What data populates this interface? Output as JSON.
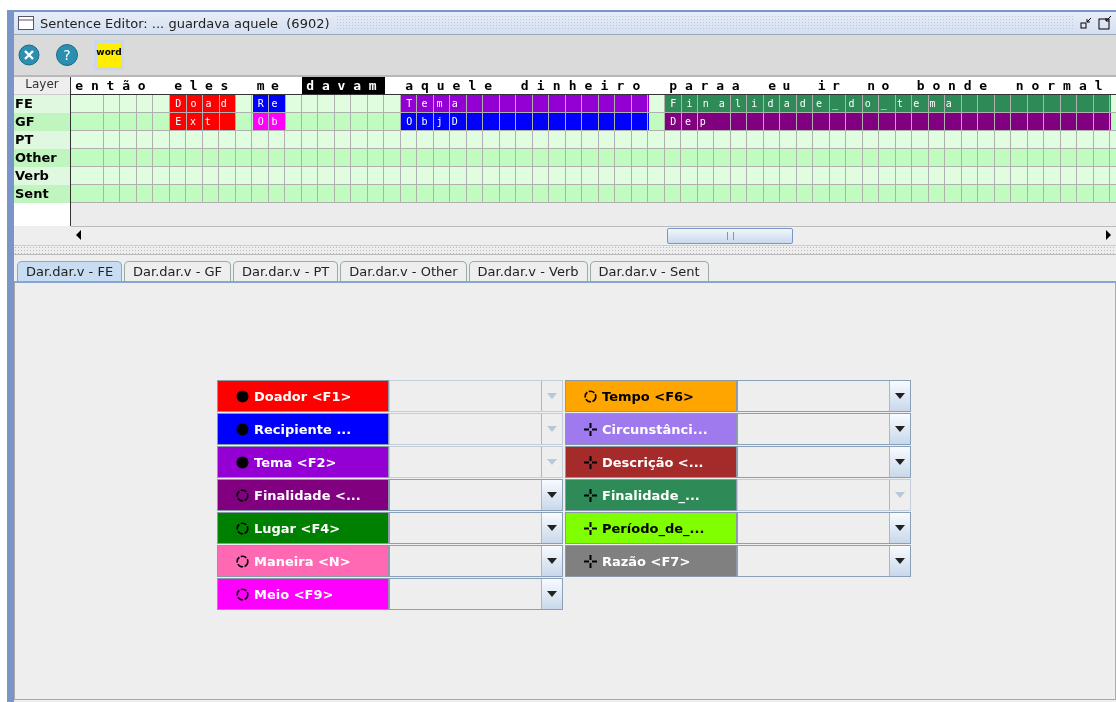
{
  "window": {
    "title": "Sentence Editor: ... guardava aquele  (6902)"
  },
  "toolbar": [
    {
      "kind": "close"
    },
    {
      "kind": "help",
      "label": "?"
    },
    {
      "kind": "word",
      "label": "word"
    }
  ],
  "grid": {
    "header": "Layer",
    "layers": [
      {
        "name": "FE",
        "kind": "fe"
      },
      {
        "name": "GF",
        "kind": "gf"
      },
      {
        "name": "PT",
        "kind": "pt"
      },
      {
        "name": "Other",
        "kind": "other"
      },
      {
        "name": "Verb",
        "kind": "verb"
      },
      {
        "name": "Sent",
        "kind": "sent"
      }
    ],
    "phrases": [
      {
        "words": [
          {
            "text": "então",
            "selected": false
          }
        ]
      },
      {
        "words": [
          {
            "text": "eles",
            "selected": false
          }
        ],
        "fe": {
          "label": "Doad",
          "color": "#ff0000"
        },
        "gf": {
          "label": "Ext",
          "color": "#ff0000"
        }
      },
      {
        "words": [
          {
            "text": "me",
            "selected": false
          }
        ],
        "fe": {
          "label": "Re",
          "color": "#0000ff"
        },
        "gf": {
          "label": "Ob",
          "color": "#ff00ff"
        }
      },
      {
        "words": [
          {
            "text": "davam",
            "selected": true
          }
        ]
      },
      {
        "words": [
          {
            "text": "aquele",
            "selected": false
          },
          {
            "text": "dinheiro",
            "selected": false
          }
        ],
        "fe": {
          "label": "Tema",
          "color": "#9400d3"
        },
        "gf": {
          "label": "ObjD",
          "color": "#0000ff"
        }
      },
      {
        "words": [
          {
            "text": "paraa",
            "selected": false
          },
          {
            "text": "eu",
            "selected": false
          },
          {
            "text": "ir",
            "selected": false
          },
          {
            "text": "no",
            "selected": false
          },
          {
            "text": "bonde",
            "selected": false
          },
          {
            "text": "normal",
            "selected": false
          }
        ],
        "fe": {
          "label": "Finalidade_do_tema",
          "color": "#2e8b57"
        },
        "gf": {
          "label": "Dep",
          "color": "#800080"
        }
      }
    ]
  },
  "tabs": [
    {
      "label": "Dar.dar.v - FE",
      "selected": true
    },
    {
      "label": "Dar.dar.v - GF",
      "selected": false
    },
    {
      "label": "Dar.dar.v - PT",
      "selected": false
    },
    {
      "label": "Dar.dar.v - Other",
      "selected": false
    },
    {
      "label": "Dar.dar.v - Verb",
      "selected": false
    },
    {
      "label": "Dar.dar.v - Sent",
      "selected": false
    }
  ],
  "frame_elements": [
    [
      {
        "label": "Doador <F1>",
        "color": "#ff0000",
        "kind": "core",
        "disabled": true
      },
      {
        "label": "Recipiente ...",
        "color": "#0000ff",
        "kind": "core",
        "disabled": true
      },
      {
        "label": "Tema <F2>",
        "color": "#9400d3",
        "kind": "core",
        "disabled": true
      },
      {
        "label": "Finalidade <...",
        "color": "#800080",
        "kind": "peripheral",
        "disabled": false
      },
      {
        "label": "Lugar <F4>",
        "color": "#008000",
        "kind": "peripheral",
        "disabled": false
      },
      {
        "label": "Maneira <N>",
        "color": "#ff69b4",
        "kind": "peripheral",
        "disabled": false
      },
      {
        "label": "Meio <F9>",
        "color": "#ff00ff",
        "kind": "peripheral",
        "disabled": false
      }
    ],
    [
      {
        "label": "Tempo <F6>",
        "color": "#ffa500",
        "kind": "peripheral",
        "disabled": false
      },
      {
        "label": "Circunstânci...",
        "color": "#9f79ee",
        "kind": "extra",
        "disabled": false
      },
      {
        "label": "Descrição <...",
        "color": "#a52a2a",
        "kind": "extra",
        "disabled": false
      },
      {
        "label": "Finalidade_...",
        "color": "#2e8b57",
        "kind": "extra",
        "disabled": true
      },
      {
        "label": "Período_de_...",
        "color": "#7fff00",
        "kind": "extra",
        "disabled": false
      },
      {
        "label": "Razão <F7>",
        "color": "#808080",
        "kind": "extra",
        "disabled": false
      }
    ]
  ]
}
